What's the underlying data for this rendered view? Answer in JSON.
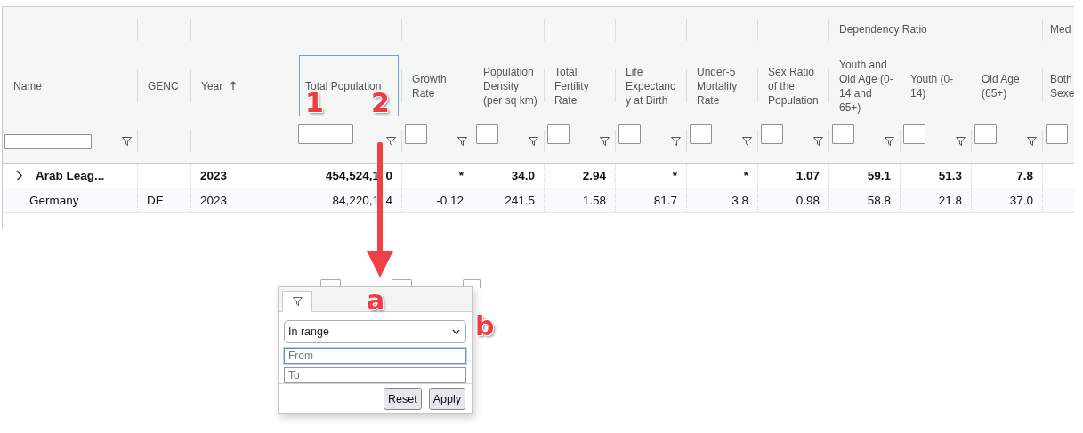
{
  "table": {
    "columns": [
      {
        "label": "Name",
        "filter_input": true,
        "filter_icon": true
      },
      {
        "label": "GENC",
        "filter_input": false,
        "filter_icon": false
      },
      {
        "label": "Year",
        "sorted": true,
        "filter_input": false,
        "filter_icon": false
      },
      {
        "label": "Total Population",
        "focused": true,
        "filter_input": true,
        "filter_icon": true
      },
      {
        "label": "Growth Rate",
        "filter_input": true,
        "filter_icon": true
      },
      {
        "label": "Population Density (per sq km)",
        "filter_input": true,
        "filter_icon": true
      },
      {
        "label": "Total Fertility Rate",
        "filter_input": true,
        "filter_icon": true
      },
      {
        "label": "Life Expectancy at Birth",
        "filter_input": true,
        "filter_icon": true
      },
      {
        "label": "Under-5 Mortality Rate",
        "filter_input": true,
        "filter_icon": true
      },
      {
        "label": "Sex Ratio of the Population",
        "filter_input": true,
        "filter_icon": true
      },
      {
        "label": "Youth and Old Age (0-14 and 65+)",
        "group": "Dependency Ratio",
        "filter_input": true,
        "filter_icon": true
      },
      {
        "label": "Youth (0-14)",
        "group_member": true,
        "filter_input": true,
        "filter_icon": true
      },
      {
        "label": "Old Age (65+)",
        "group_member": true,
        "filter_input": true,
        "filter_icon": true
      },
      {
        "label": "Both Sexe",
        "group": "Med",
        "filter_input": true,
        "filter_icon": false
      }
    ],
    "rows": [
      {
        "kind": "group",
        "expanded": false,
        "cells": [
          "Arab Leag...",
          null,
          "2023",
          "454,524,1 0",
          "*",
          "34.0",
          "2.94",
          "*",
          "*",
          "1.07",
          "59.1",
          "51.3",
          "7.8"
        ]
      },
      {
        "kind": "item",
        "cells": [
          "Germany",
          "DE",
          "2023",
          "84,220,1 4",
          "-0.12",
          "241.5",
          "1.58",
          "81.7",
          "3.8",
          "0.98",
          "58.8",
          "21.8",
          "37.0"
        ]
      }
    ]
  },
  "filter_popup": {
    "tab": {
      "selected": true
    },
    "operator": "In range",
    "inputs": [
      {
        "placeholder": "From",
        "focused": true
      },
      {
        "placeholder": "To",
        "focused": false
      }
    ],
    "buttons": [
      "Reset",
      "Apply"
    ]
  },
  "annotations": [
    "1",
    "2",
    "a",
    "b"
  ]
}
